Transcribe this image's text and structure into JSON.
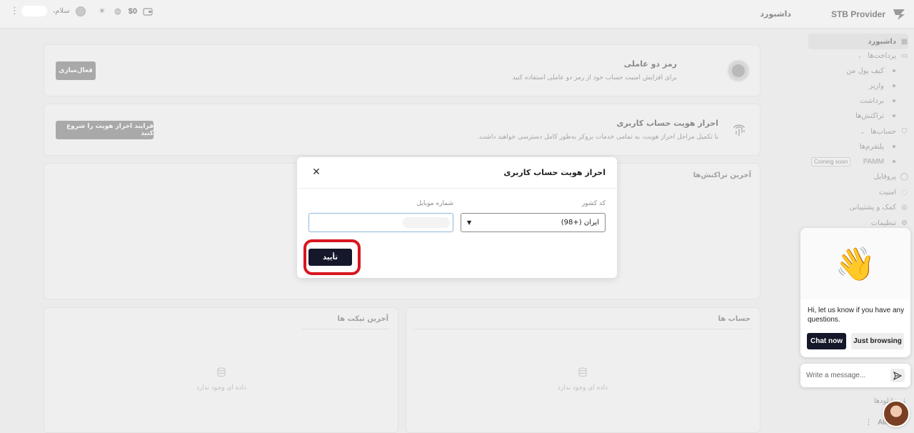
{
  "topbar": {
    "brand_name": "STB Provider",
    "page_heading": "داشبورد",
    "greeting": "سلام،",
    "balance": "$0"
  },
  "sidebar": {
    "items": [
      {
        "label": "داشبورد",
        "icon": "grid-icon"
      },
      {
        "label": "پرداخت‌ها",
        "icon": "card-icon"
      },
      {
        "label": "کیف پول من"
      },
      {
        "label": "واریز"
      },
      {
        "label": "برداشت"
      },
      {
        "label": "تراکنش‌ها"
      },
      {
        "label": "حساب‌ها",
        "icon": "shield-icon"
      },
      {
        "label": "پلتفرم‌ها"
      },
      {
        "label": "PAMM",
        "badge": "Coming soon"
      },
      {
        "label": "پروفایل",
        "icon": "user-icon"
      },
      {
        "label": "امنیت",
        "icon": "lock-icon"
      },
      {
        "label": "کمک و پشتیبانی",
        "icon": "help-icon"
      },
      {
        "label": "تنظیمات",
        "icon": "gear-icon"
      },
      {
        "label": "دانلودها"
      }
    ],
    "user_name": "Alireza"
  },
  "cards": {
    "tfa": {
      "title": "رمز دو عاملی",
      "desc": "برای افزایش امنیت حساب خود از رمز دو عاملی استفاده کنید",
      "button": "فعال‌سازی"
    },
    "kyc": {
      "title": "احراز هویت حساب کاربری",
      "desc": "با تکمیل مراحل احراز هویت، به تمامی خدمات بروکر به‌طور کامل دسترسی خواهید داشت.",
      "button": "فرایند احراز هویت را شروع کنید"
    },
    "transactions_title": "آخرین تراکنش‌ها",
    "tickets_title": "آخرین تیکت ها",
    "accounts_title": "حساب ها",
    "empty_text": "داده ای وجود ندارد"
  },
  "modal": {
    "title": "احراز هویت حساب کاربری",
    "country_label": "کد کشور",
    "country_value": "ایران (+98)",
    "mobile_label": "شماره موبایل",
    "mobile_value": "",
    "confirm": "تأیید"
  },
  "chat": {
    "emoji": "👋",
    "message": "Hi, let us know if you have any questions.",
    "chat_now": "Chat now",
    "just_browsing": "Just browsing",
    "input_placeholder": "Write a message..."
  },
  "colors": {
    "primary_dark": "#15182a",
    "highlight_red": "#d9161f"
  }
}
